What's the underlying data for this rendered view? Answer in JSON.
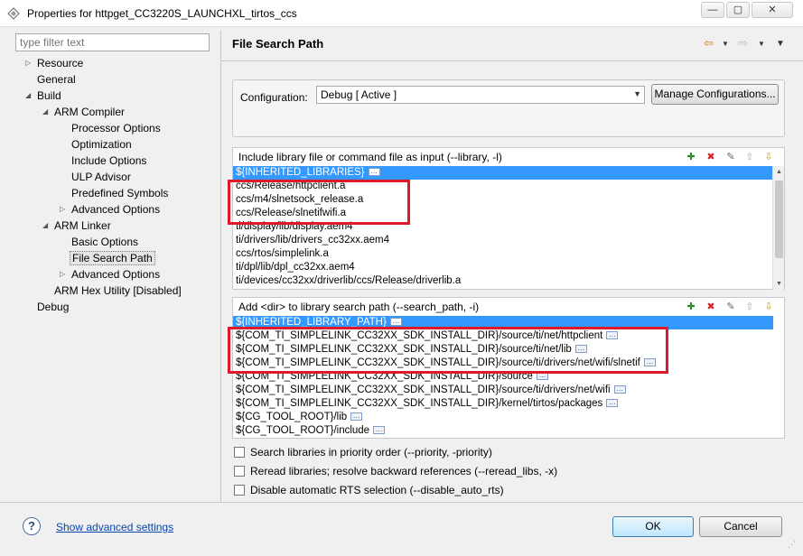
{
  "window": {
    "title": "Properties for httpget_CC3220S_LAUNCHXL_tirtos_ccs",
    "minimize": "—",
    "maximize": "▢",
    "close": "✕"
  },
  "filter": {
    "placeholder": "type filter text"
  },
  "tree": [
    {
      "label": "Resource",
      "twisty": "▷"
    },
    {
      "label": "General",
      "twisty": ""
    },
    {
      "label": "Build",
      "twisty": "◢"
    },
    {
      "label": "ARM Compiler",
      "twisty": "◢"
    },
    {
      "label": "Processor Options",
      "twisty": ""
    },
    {
      "label": "Optimization",
      "twisty": ""
    },
    {
      "label": "Include Options",
      "twisty": ""
    },
    {
      "label": "ULP Advisor",
      "twisty": ""
    },
    {
      "label": "Predefined Symbols",
      "twisty": ""
    },
    {
      "label": "Advanced Options",
      "twisty": "▷"
    },
    {
      "label": "ARM Linker",
      "twisty": "◢"
    },
    {
      "label": "Basic Options",
      "twisty": ""
    },
    {
      "label": "File Search Path",
      "twisty": ""
    },
    {
      "label": "Advanced Options",
      "twisty": "▷"
    },
    {
      "label": "ARM Hex Utility  [Disabled]",
      "twisty": ""
    },
    {
      "label": "Debug",
      "twisty": ""
    }
  ],
  "page": {
    "title": "File Search Path"
  },
  "config": {
    "label": "Configuration:",
    "value": "Debug  [ Active ]",
    "manage": "Manage Configurations..."
  },
  "section1": {
    "header": "Include library file or command file as input (--library, -l)",
    "items": [
      "${INHERITED_LIBRARIES}",
      "ccs/Release/httpclient.a",
      "ccs/m4/slnetsock_release.a",
      "ccs/Release/slnetifwifi.a",
      "ti/display/lib/display.aem4",
      "ti/drivers/lib/drivers_cc32xx.aem4",
      "ccs/rtos/simplelink.a",
      "ti/dpl/lib/dpl_cc32xx.aem4",
      "ti/devices/cc32xx/driverlib/ccs/Release/driverlib.a"
    ]
  },
  "section2": {
    "header": "Add <dir> to library search path (--search_path, -i)",
    "items": [
      "${INHERITED_LIBRARY_PATH}",
      "${COM_TI_SIMPLELINK_CC32XX_SDK_INSTALL_DIR}/source/ti/net/httpclient",
      "${COM_TI_SIMPLELINK_CC32XX_SDK_INSTALL_DIR}/source/ti/net/lib",
      "${COM_TI_SIMPLELINK_CC32XX_SDK_INSTALL_DIR}/source/ti/drivers/net/wifi/slnetif",
      "${COM_TI_SIMPLELINK_CC32XX_SDK_INSTALL_DIR}/source",
      "${COM_TI_SIMPLELINK_CC32XX_SDK_INSTALL_DIR}/source/ti/drivers/net/wifi",
      "${COM_TI_SIMPLELINK_CC32XX_SDK_INSTALL_DIR}/kernel/tirtos/packages",
      "${CG_TOOL_ROOT}/lib",
      "${CG_TOOL_ROOT}/include"
    ]
  },
  "options": {
    "priority": "Search libraries in priority order (--priority, -priority)",
    "reread": "Reread libraries; resolve backward references (--reread_libs, -x)",
    "disable_rts": "Disable automatic RTS selection (--disable_auto_rts)"
  },
  "footer": {
    "help": "?",
    "advanced": "Show advanced settings",
    "ok": "OK",
    "cancel": "Cancel"
  },
  "colors": {
    "selection": "#3399ff",
    "highlight": "#e0182d",
    "link": "#0645ad"
  }
}
